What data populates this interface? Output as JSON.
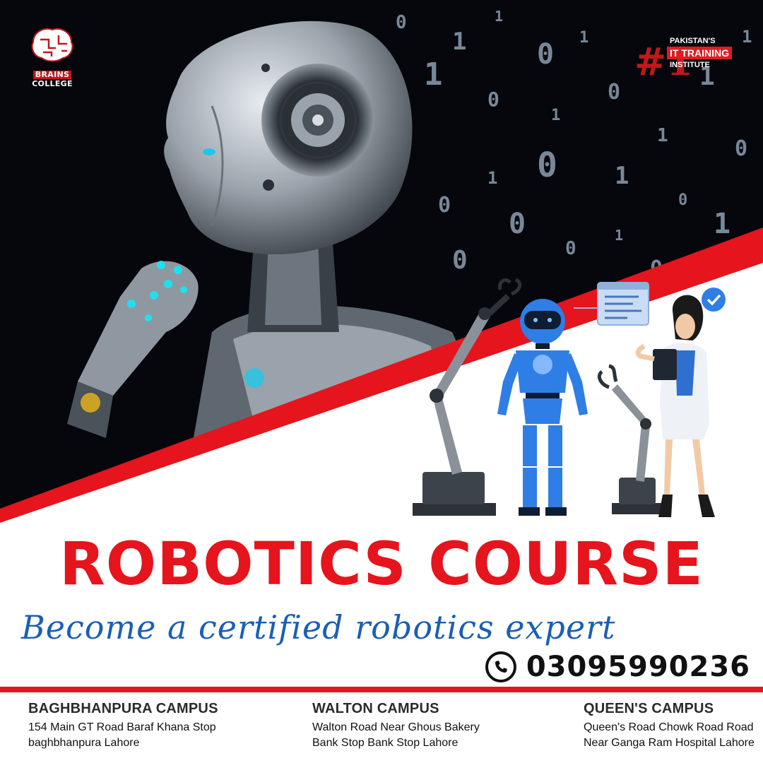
{
  "colors": {
    "brand_red": "#e6141c",
    "tagline_blue": "#1a5fb4",
    "hero_black": "#05070c",
    "robot_blue": "#2f7ee6"
  },
  "brand": {
    "logo_line1": "BRAINS",
    "logo_line2": "COLLEGE",
    "logo_icon": "brain-icon"
  },
  "badge": {
    "rank": "#1",
    "line1": "PAKISTAN'S",
    "line2": "IT TRAINING",
    "line3": "INSTITUTE"
  },
  "headline": {
    "title": "ROBOTICS COURSE",
    "tagline": "Become a certified robotics expert"
  },
  "contact": {
    "phone_icon": "phone-icon",
    "phone": "03095990236"
  },
  "campuses": [
    {
      "name": "BAGHBHANPURA CAMPUS",
      "address": "154 Main GT Road Baraf Khana Stop\n baghbhanpura Lahore"
    },
    {
      "name": "WALTON CAMPUS",
      "address": "Walton Road Near Ghous Bakery\nBank Stop Bank Stop Lahore"
    },
    {
      "name": "QUEEN'S CAMPUS",
      "address": "Queen's Road Chowk Road Road\nNear Ganga Ram Hospital Lahore"
    }
  ],
  "illustration": {
    "hero_icon": "android-head-icon",
    "robot_icon": "blue-robot-icon",
    "arm_icon": "robotic-arm-icon",
    "engineer_icon": "engineer-woman-icon",
    "check_icon": "check-badge-icon",
    "screen_icon": "code-window-icon"
  }
}
